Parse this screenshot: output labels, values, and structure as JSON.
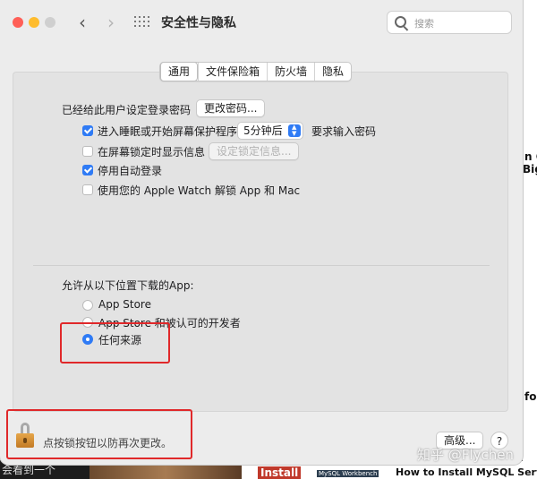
{
  "window": {
    "title": "安全性与隐私",
    "search_placeholder": "搜索"
  },
  "tabs": [
    {
      "label": "通用",
      "active": true
    },
    {
      "label": "文件保险箱",
      "active": false
    },
    {
      "label": "防火墙",
      "active": false
    },
    {
      "label": "隐私",
      "active": false
    }
  ],
  "general": {
    "password_set_label": "已经给此用户设定登录密码",
    "change_password_button": "更改密码...",
    "require_password": {
      "checked": true,
      "label_before": "进入睡眠或开始屏幕保护程序",
      "delay_value": "5分钟后",
      "label_after": "要求输入密码"
    },
    "show_message": {
      "checked": false,
      "label": "在屏幕锁定时显示信息",
      "button": "设定锁定信息..."
    },
    "disable_auto_login": {
      "checked": true,
      "label": "停用自动登录"
    },
    "apple_watch_unlock": {
      "checked": false,
      "label": "使用您的 Apple Watch 解锁 App 和 Mac"
    }
  },
  "downloads": {
    "heading": "允许从以下位置下载的App:",
    "options": [
      {
        "label": "App Store",
        "selected": false
      },
      {
        "label": "App Store 和被认可的开发者",
        "selected": false
      },
      {
        "label": "任何来源",
        "selected": true
      }
    ]
  },
  "footer": {
    "lock_text": "点按锁按钮以防再次更改。",
    "advanced_button": "高级...",
    "help_button": "?"
  },
  "background": {
    "right_snippets": [
      "n Q",
      "Big",
      "fo"
    ],
    "bottom_left_text": "会看到一个",
    "bottom_install": "Install",
    "bottom_workbench": "MySQL Workbench",
    "bottom_right_text": "How to Install MySQL Serve",
    "watermark": "知乎 @Flychen"
  },
  "colors": {
    "accent": "#2f7bf5",
    "highlight": "#e0282a"
  }
}
